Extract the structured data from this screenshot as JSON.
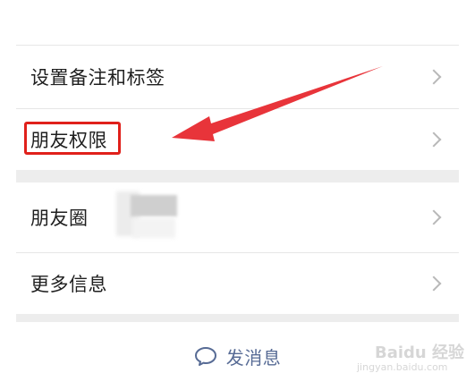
{
  "settings": {
    "rows": [
      {
        "label": "设置备注和标签"
      },
      {
        "label": "朋友权限"
      },
      {
        "label": "朋友圈"
      },
      {
        "label": "更多信息"
      }
    ]
  },
  "actions": {
    "send_message_label": "发消息",
    "send_message_icon": "chat-bubble-icon"
  },
  "annotation": {
    "highlight_color": "#e0201b",
    "arrow_color": "#e8343a"
  },
  "watermark": {
    "main_text": "Baidu 经验",
    "url_text": "jingyan.baidu.com"
  },
  "colors": {
    "link_blue": "#576b95",
    "background": "#ffffff",
    "separator": "#ededed"
  }
}
